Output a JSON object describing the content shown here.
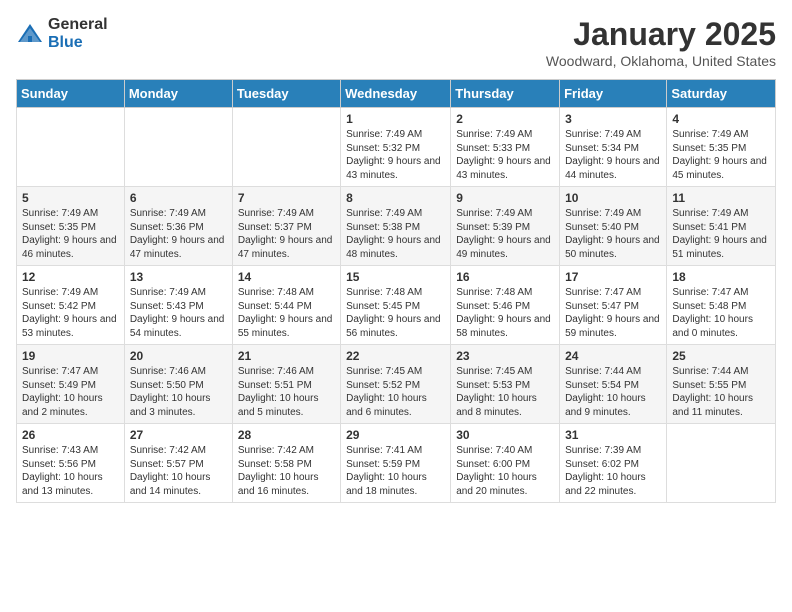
{
  "header": {
    "logo_general": "General",
    "logo_blue": "Blue",
    "month_title": "January 2025",
    "location": "Woodward, Oklahoma, United States"
  },
  "days_of_week": [
    "Sunday",
    "Monday",
    "Tuesday",
    "Wednesday",
    "Thursday",
    "Friday",
    "Saturday"
  ],
  "weeks": [
    [
      {
        "day": "",
        "info": ""
      },
      {
        "day": "",
        "info": ""
      },
      {
        "day": "",
        "info": ""
      },
      {
        "day": "1",
        "info": "Sunrise: 7:49 AM\nSunset: 5:32 PM\nDaylight: 9 hours and 43 minutes."
      },
      {
        "day": "2",
        "info": "Sunrise: 7:49 AM\nSunset: 5:33 PM\nDaylight: 9 hours and 43 minutes."
      },
      {
        "day": "3",
        "info": "Sunrise: 7:49 AM\nSunset: 5:34 PM\nDaylight: 9 hours and 44 minutes."
      },
      {
        "day": "4",
        "info": "Sunrise: 7:49 AM\nSunset: 5:35 PM\nDaylight: 9 hours and 45 minutes."
      }
    ],
    [
      {
        "day": "5",
        "info": "Sunrise: 7:49 AM\nSunset: 5:35 PM\nDaylight: 9 hours and 46 minutes."
      },
      {
        "day": "6",
        "info": "Sunrise: 7:49 AM\nSunset: 5:36 PM\nDaylight: 9 hours and 47 minutes."
      },
      {
        "day": "7",
        "info": "Sunrise: 7:49 AM\nSunset: 5:37 PM\nDaylight: 9 hours and 47 minutes."
      },
      {
        "day": "8",
        "info": "Sunrise: 7:49 AM\nSunset: 5:38 PM\nDaylight: 9 hours and 48 minutes."
      },
      {
        "day": "9",
        "info": "Sunrise: 7:49 AM\nSunset: 5:39 PM\nDaylight: 9 hours and 49 minutes."
      },
      {
        "day": "10",
        "info": "Sunrise: 7:49 AM\nSunset: 5:40 PM\nDaylight: 9 hours and 50 minutes."
      },
      {
        "day": "11",
        "info": "Sunrise: 7:49 AM\nSunset: 5:41 PM\nDaylight: 9 hours and 51 minutes."
      }
    ],
    [
      {
        "day": "12",
        "info": "Sunrise: 7:49 AM\nSunset: 5:42 PM\nDaylight: 9 hours and 53 minutes."
      },
      {
        "day": "13",
        "info": "Sunrise: 7:49 AM\nSunset: 5:43 PM\nDaylight: 9 hours and 54 minutes."
      },
      {
        "day": "14",
        "info": "Sunrise: 7:48 AM\nSunset: 5:44 PM\nDaylight: 9 hours and 55 minutes."
      },
      {
        "day": "15",
        "info": "Sunrise: 7:48 AM\nSunset: 5:45 PM\nDaylight: 9 hours and 56 minutes."
      },
      {
        "day": "16",
        "info": "Sunrise: 7:48 AM\nSunset: 5:46 PM\nDaylight: 9 hours and 58 minutes."
      },
      {
        "day": "17",
        "info": "Sunrise: 7:47 AM\nSunset: 5:47 PM\nDaylight: 9 hours and 59 minutes."
      },
      {
        "day": "18",
        "info": "Sunrise: 7:47 AM\nSunset: 5:48 PM\nDaylight: 10 hours and 0 minutes."
      }
    ],
    [
      {
        "day": "19",
        "info": "Sunrise: 7:47 AM\nSunset: 5:49 PM\nDaylight: 10 hours and 2 minutes."
      },
      {
        "day": "20",
        "info": "Sunrise: 7:46 AM\nSunset: 5:50 PM\nDaylight: 10 hours and 3 minutes."
      },
      {
        "day": "21",
        "info": "Sunrise: 7:46 AM\nSunset: 5:51 PM\nDaylight: 10 hours and 5 minutes."
      },
      {
        "day": "22",
        "info": "Sunrise: 7:45 AM\nSunset: 5:52 PM\nDaylight: 10 hours and 6 minutes."
      },
      {
        "day": "23",
        "info": "Sunrise: 7:45 AM\nSunset: 5:53 PM\nDaylight: 10 hours and 8 minutes."
      },
      {
        "day": "24",
        "info": "Sunrise: 7:44 AM\nSunset: 5:54 PM\nDaylight: 10 hours and 9 minutes."
      },
      {
        "day": "25",
        "info": "Sunrise: 7:44 AM\nSunset: 5:55 PM\nDaylight: 10 hours and 11 minutes."
      }
    ],
    [
      {
        "day": "26",
        "info": "Sunrise: 7:43 AM\nSunset: 5:56 PM\nDaylight: 10 hours and 13 minutes."
      },
      {
        "day": "27",
        "info": "Sunrise: 7:42 AM\nSunset: 5:57 PM\nDaylight: 10 hours and 14 minutes."
      },
      {
        "day": "28",
        "info": "Sunrise: 7:42 AM\nSunset: 5:58 PM\nDaylight: 10 hours and 16 minutes."
      },
      {
        "day": "29",
        "info": "Sunrise: 7:41 AM\nSunset: 5:59 PM\nDaylight: 10 hours and 18 minutes."
      },
      {
        "day": "30",
        "info": "Sunrise: 7:40 AM\nSunset: 6:00 PM\nDaylight: 10 hours and 20 minutes."
      },
      {
        "day": "31",
        "info": "Sunrise: 7:39 AM\nSunset: 6:02 PM\nDaylight: 10 hours and 22 minutes."
      },
      {
        "day": "",
        "info": ""
      }
    ]
  ]
}
